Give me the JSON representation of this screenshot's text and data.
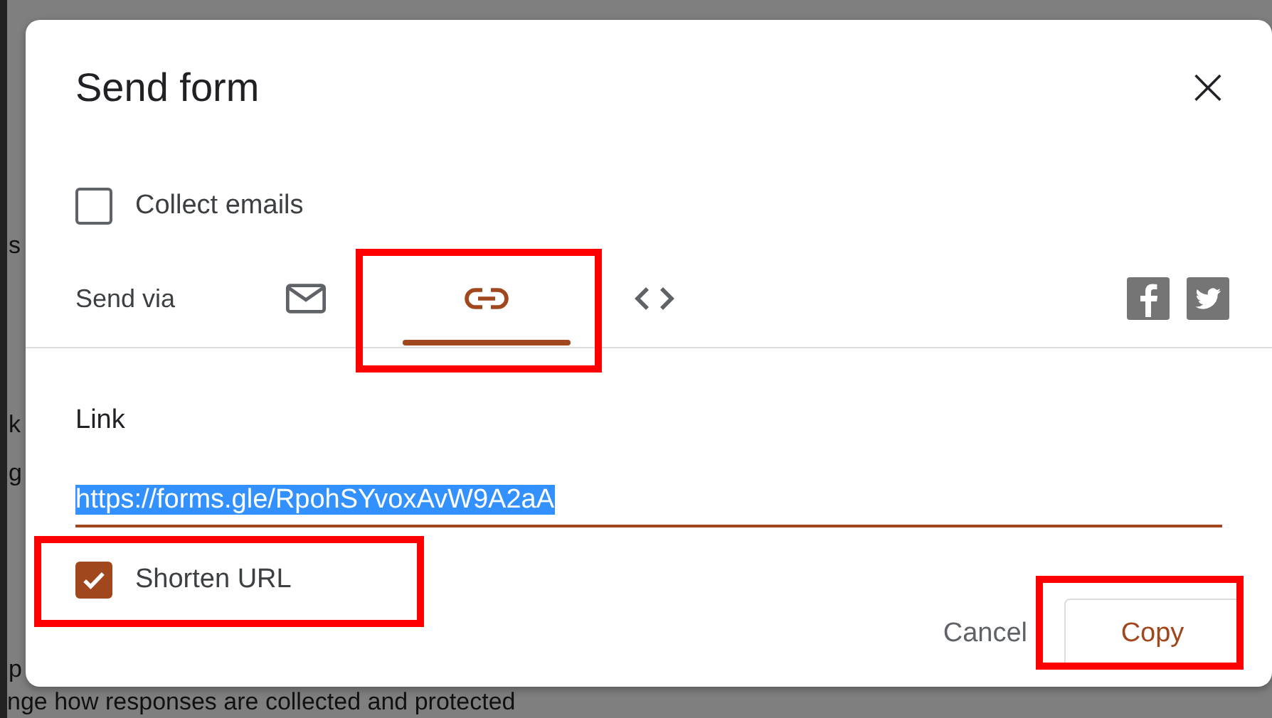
{
  "background": {
    "fragments": [
      "s",
      "k",
      "g",
      "p"
    ],
    "footer_text": "nge how responses are collected and protected"
  },
  "dialog": {
    "title": "Send form",
    "close_icon": "×",
    "collect_emails": {
      "label": "Collect emails",
      "checked": false
    },
    "send_via": {
      "label": "Send via",
      "tabs": [
        {
          "kind": "mail",
          "selected": false,
          "highlighted": false
        },
        {
          "kind": "link",
          "selected": true,
          "highlighted": true
        },
        {
          "kind": "code",
          "selected": false,
          "highlighted": false
        }
      ],
      "share": [
        {
          "kind": "facebook"
        },
        {
          "kind": "twitter"
        }
      ]
    },
    "link": {
      "label": "Link",
      "value": "https://forms.gle/RpohSYvoxAvW9A2aA",
      "text_selected": true
    },
    "shorten_url": {
      "label": "Shorten URL",
      "checked": true,
      "highlighted": true
    },
    "buttons": [
      {
        "label": "Cancel",
        "kind": "text",
        "highlighted": false
      },
      {
        "label": "Copy",
        "kind": "outlined",
        "highlighted": true
      }
    ]
  }
}
